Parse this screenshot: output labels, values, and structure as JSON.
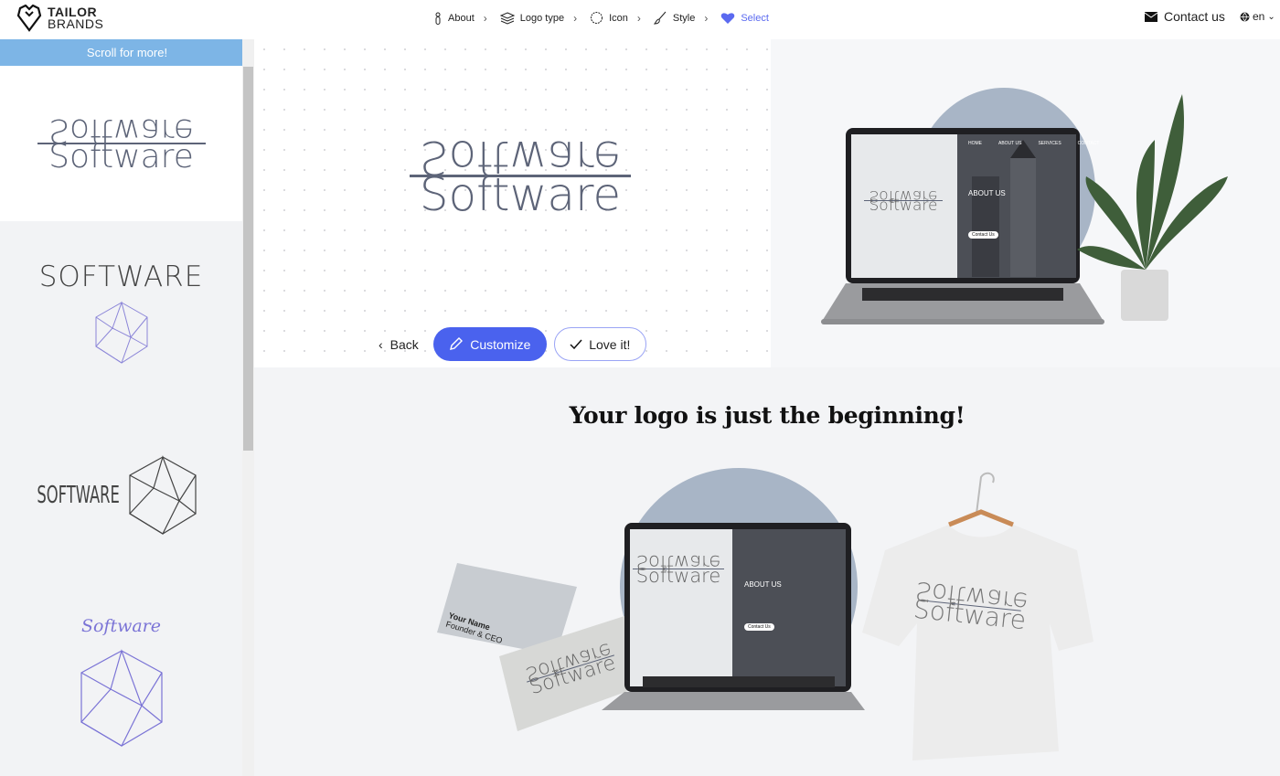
{
  "header": {
    "brand": {
      "line1": "TAILOR",
      "line2": "BRANDS"
    },
    "steps": [
      {
        "label": "About",
        "icon": "person-icon"
      },
      {
        "label": "Logo type",
        "icon": "layers-icon"
      },
      {
        "label": "Icon",
        "icon": "circle-icon"
      },
      {
        "label": "Style",
        "icon": "brush-icon"
      },
      {
        "label": "Select",
        "icon": "heart-icon",
        "active": true
      }
    ],
    "contact_label": "Contact us",
    "language": "en"
  },
  "sidebar": {
    "banner": "Scroll for more!",
    "items": [
      {
        "text": "Software",
        "style": "mirrored"
      },
      {
        "text": "SOFTWARE",
        "style": "thin caps with icosahedron"
      },
      {
        "text": "SOFTWARE",
        "style": "condensed with icosahedron"
      },
      {
        "text": "Software",
        "style": "script with icosahedron"
      }
    ]
  },
  "preview": {
    "logo_text": "Software"
  },
  "actions": {
    "back": "Back",
    "customize": "Customize",
    "love": "Love it!"
  },
  "mockup": {
    "nav": [
      "HOME",
      "ABOUT US",
      "SERVICES",
      "CONTACT"
    ],
    "about_title": "ABOUT US",
    "contact_btn": "Contact Us"
  },
  "bottom": {
    "headline": "Your logo is just the beginning!",
    "card": {
      "name": "Your Name",
      "title": "Founder & CEO"
    }
  },
  "colors": {
    "accent": "#4a62ee",
    "banner": "#7db5e6",
    "logo": "#5d6478",
    "icon_purple": "#7b74d6"
  }
}
